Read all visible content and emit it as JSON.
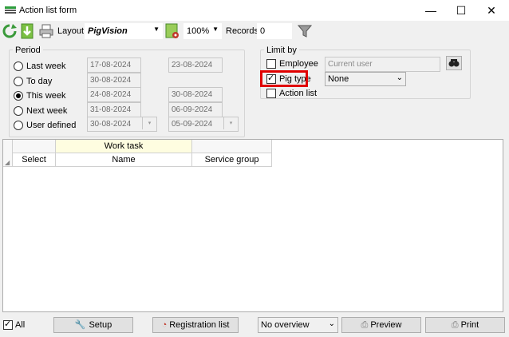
{
  "window": {
    "title": "Action list form",
    "minimize": "—",
    "maximize": "☐",
    "close": "✕"
  },
  "toolbar": {
    "layout_label": "Layout",
    "layout_value": "PigVision",
    "zoom_value": "100%",
    "records_label": "Records",
    "records_value": "0"
  },
  "period": {
    "title": "Period",
    "options": [
      {
        "label": "Last week",
        "from": "17-08-2024",
        "to": "23-08-2024",
        "checked": false
      },
      {
        "label": "To day",
        "from": "30-08-2024",
        "to": "",
        "checked": false
      },
      {
        "label": "This week",
        "from": "24-08-2024",
        "to": "30-08-2024",
        "checked": true
      },
      {
        "label": "Next week",
        "from": "31-08-2024",
        "to": "06-09-2024",
        "checked": false
      },
      {
        "label": "User defined",
        "from": "30-08-2024",
        "to": "05-09-2024",
        "checked": false
      }
    ]
  },
  "limit": {
    "title": "Limit by",
    "employee_label": "Employee",
    "employee_value": "Current user",
    "pigtype_label": "Pig type",
    "pigtype_value": "None",
    "actionlist_label": "Action list"
  },
  "grid": {
    "band_header": "Work task",
    "columns": [
      "Select",
      "Name",
      "Service group"
    ]
  },
  "footer": {
    "all_label": "All",
    "setup_label": "Setup",
    "registration_label": "Registration list",
    "overview_value": "No overview",
    "preview_label": "Preview",
    "print_label": "Print"
  },
  "colors": {
    "highlight": "#e00000",
    "band": "#fefde0",
    "refresh": "#3a9a3a"
  }
}
